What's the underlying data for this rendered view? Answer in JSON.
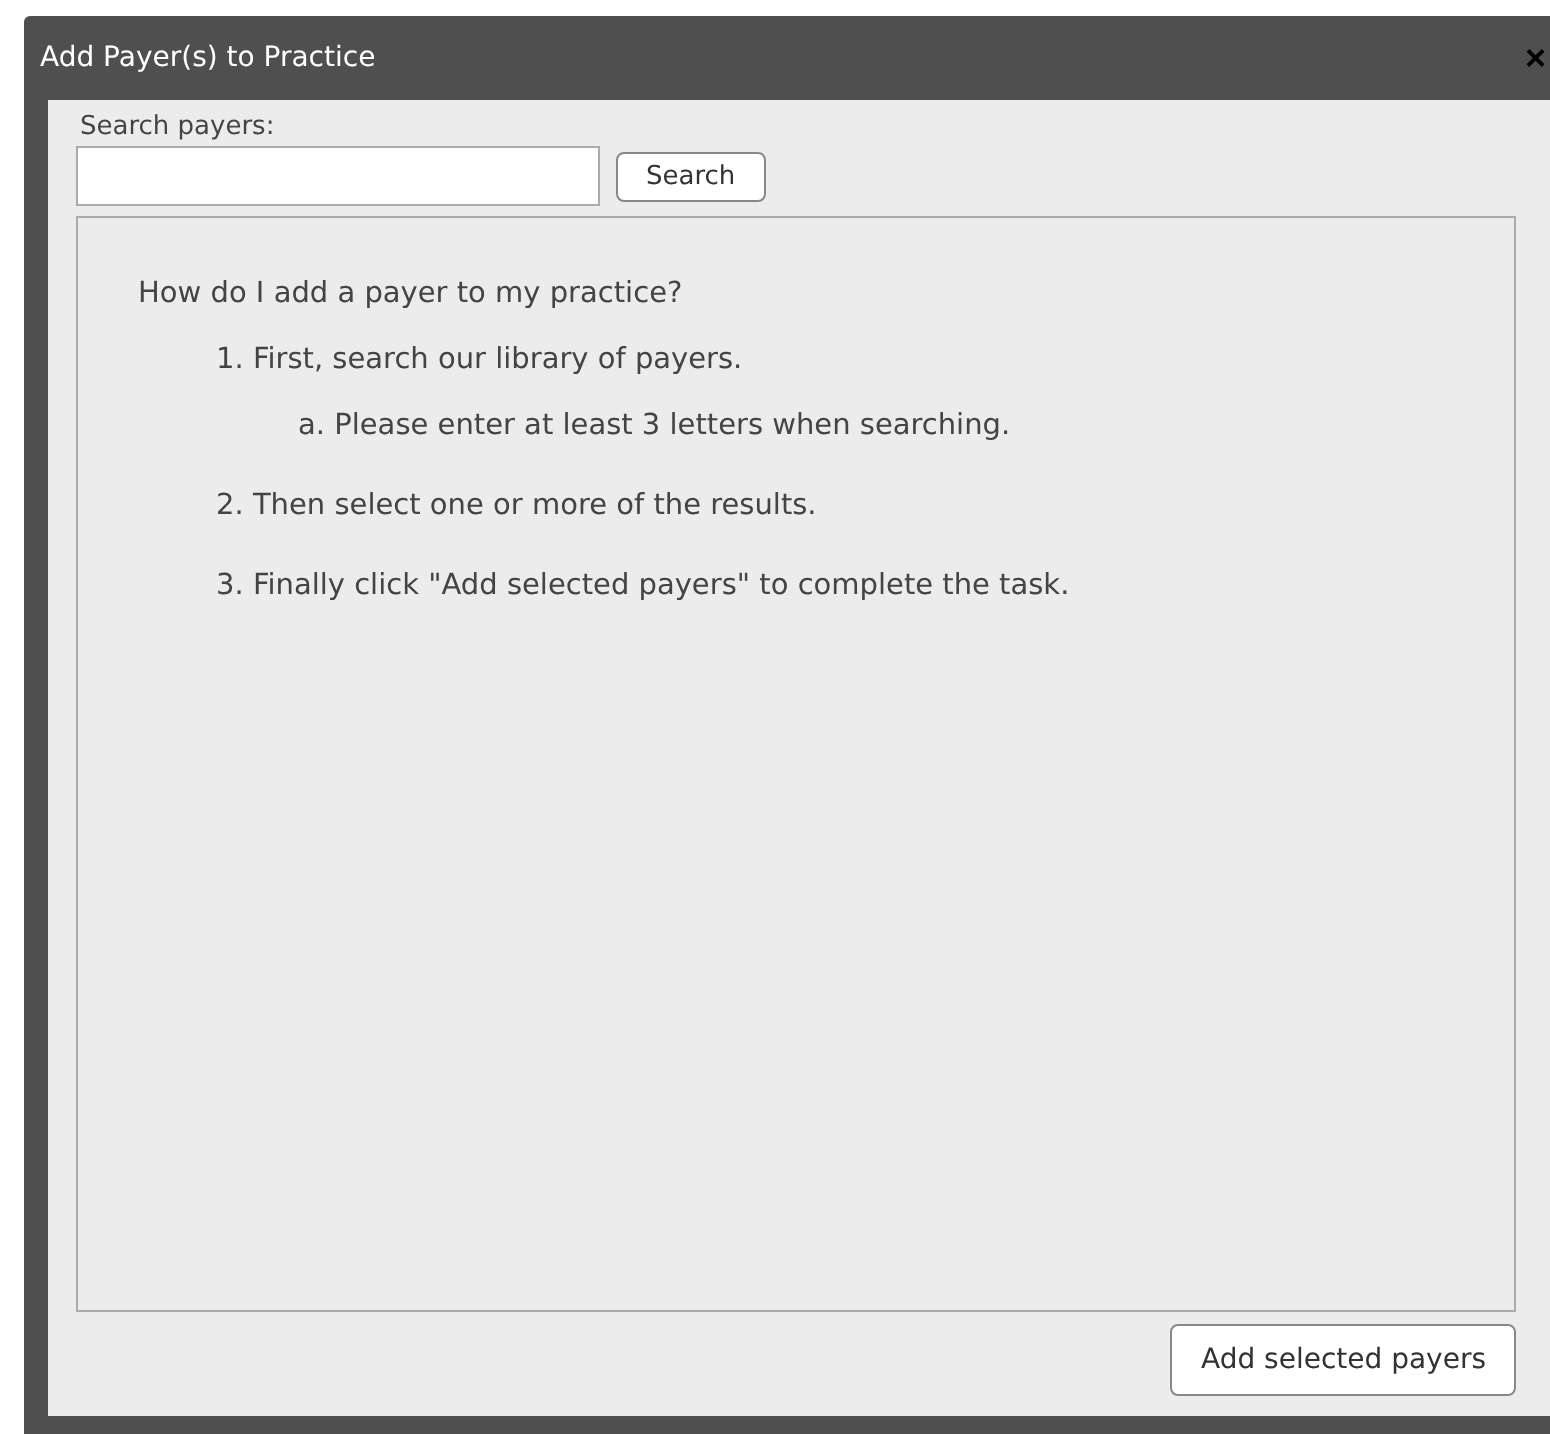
{
  "window": {
    "title": "Add Payer(s) to Practice",
    "close": "×"
  },
  "search": {
    "label": "Search payers:",
    "button": "Search"
  },
  "help": {
    "question": "How do I add a payer to my practice?",
    "steps": [
      {
        "marker": "1.",
        "text": "First, search our library of payers.",
        "children": [
          {
            "marker": "a.",
            "text": "Please enter at least 3 letters when searching."
          }
        ]
      },
      {
        "marker": "2.",
        "text": "Then select one or more of the results."
      },
      {
        "marker": "3.",
        "text": "Finally click \"Add selected payers\" to complete the task."
      }
    ]
  },
  "buttons": [
    "Add selected payers"
  ]
}
